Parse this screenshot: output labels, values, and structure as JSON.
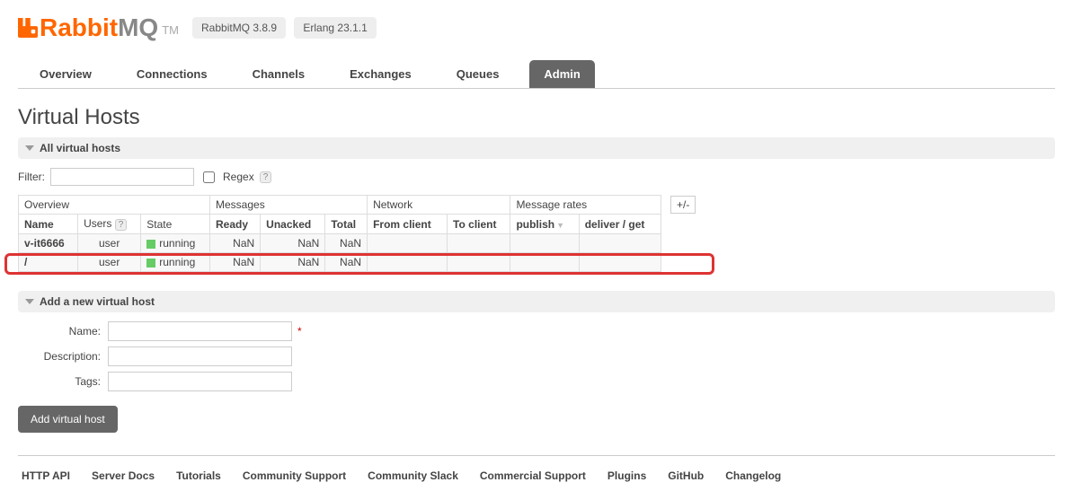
{
  "logo": {
    "rabbit": "Rabbit",
    "mq": "MQ",
    "tm": "TM"
  },
  "badges": {
    "rabbitmq": "RabbitMQ 3.8.9",
    "erlang": "Erlang 23.1.1"
  },
  "tabs": {
    "overview": "Overview",
    "connections": "Connections",
    "channels": "Channels",
    "exchanges": "Exchanges",
    "queues": "Queues",
    "admin": "Admin"
  },
  "page_title": "Virtual Hosts",
  "sections": {
    "all_vhosts": "All virtual hosts",
    "add_vhost": "Add a new virtual host"
  },
  "filter": {
    "label": "Filter:",
    "regex_label": "Regex",
    "help": "?"
  },
  "table": {
    "groups": {
      "overview": "Overview",
      "messages": "Messages",
      "network": "Network",
      "rates": "Message rates"
    },
    "cols": {
      "name": "Name",
      "users": "Users",
      "state": "State",
      "ready": "Ready",
      "unacked": "Unacked",
      "total": "Total",
      "from_client": "From client",
      "to_client": "To client",
      "publish": "publish",
      "deliver": "deliver / get"
    },
    "plusminus": "+/-",
    "users_help": "?",
    "rows": [
      {
        "name": "v-it6666",
        "users": "user",
        "state": "running",
        "ready": "NaN",
        "unacked": "NaN",
        "total": "NaN",
        "from_client": "",
        "to_client": "",
        "publish": "",
        "deliver": ""
      },
      {
        "name": "/",
        "users": "user",
        "state": "running",
        "ready": "NaN",
        "unacked": "NaN",
        "total": "NaN",
        "from_client": "",
        "to_client": "",
        "publish": "",
        "deliver": ""
      }
    ]
  },
  "form": {
    "name_label": "Name:",
    "desc_label": "Description:",
    "tags_label": "Tags:",
    "required": "*",
    "submit": "Add virtual host"
  },
  "footer": {
    "http_api": "HTTP API",
    "server_docs": "Server Docs",
    "tutorials": "Tutorials",
    "community_support": "Community Support",
    "community_slack": "Community Slack",
    "commercial_support": "Commercial Support",
    "plugins": "Plugins",
    "github": "GitHub",
    "changelog": "Changelog"
  }
}
